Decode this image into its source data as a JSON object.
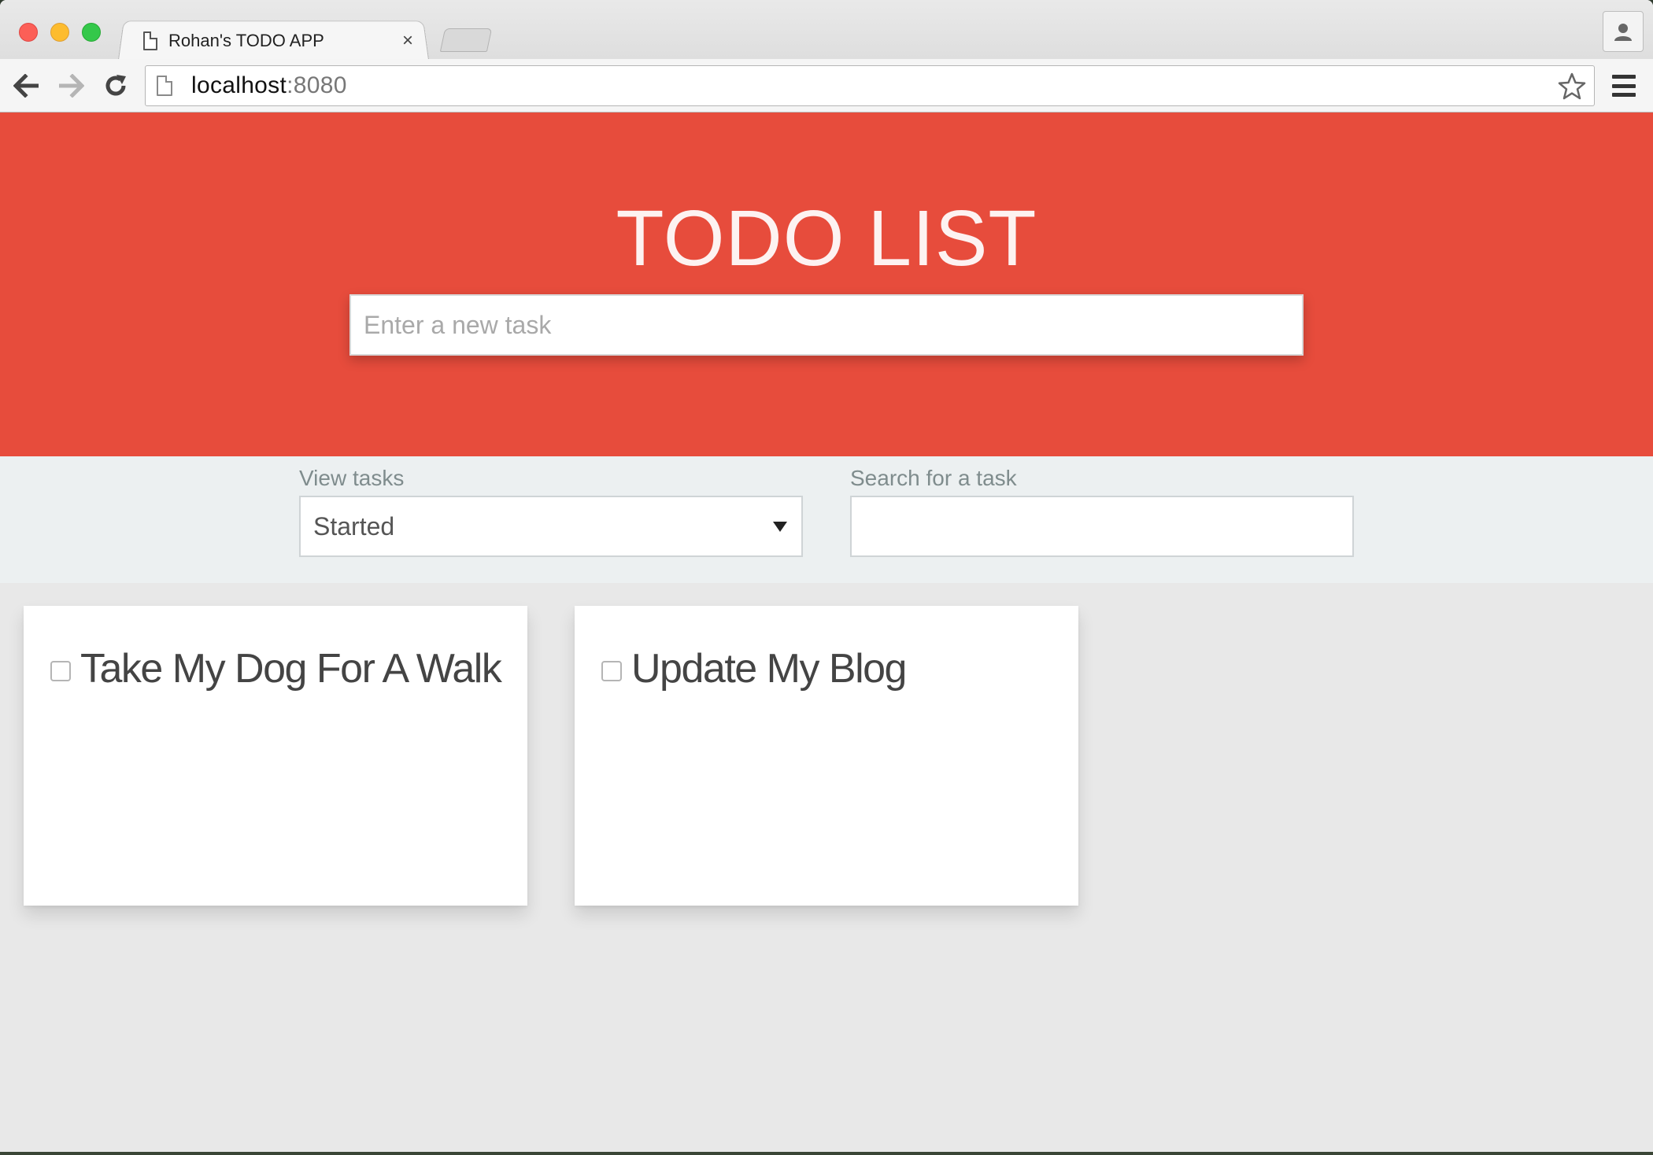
{
  "browser": {
    "tab_title": "Rohan's TODO APP",
    "tab_close_glyph": "×",
    "url_host": "localhost",
    "url_port": ":8080",
    "icons": [
      "back-arrow-icon",
      "forward-arrow-icon",
      "reload-icon",
      "page-icon",
      "star-icon",
      "menu-icon",
      "profile-icon"
    ]
  },
  "header": {
    "title": "TODO LIST",
    "new_task_placeholder": "Enter a new task",
    "new_task_value": "",
    "background_color": "#e74c3c"
  },
  "filters": {
    "view_label": "View tasks",
    "view_selected": "Started",
    "search_label": "Search for a task",
    "search_value": ""
  },
  "tasks": [
    {
      "label": "Take My Dog For A Walk",
      "checked": false
    },
    {
      "label": "Update My Blog",
      "checked": false
    }
  ]
}
